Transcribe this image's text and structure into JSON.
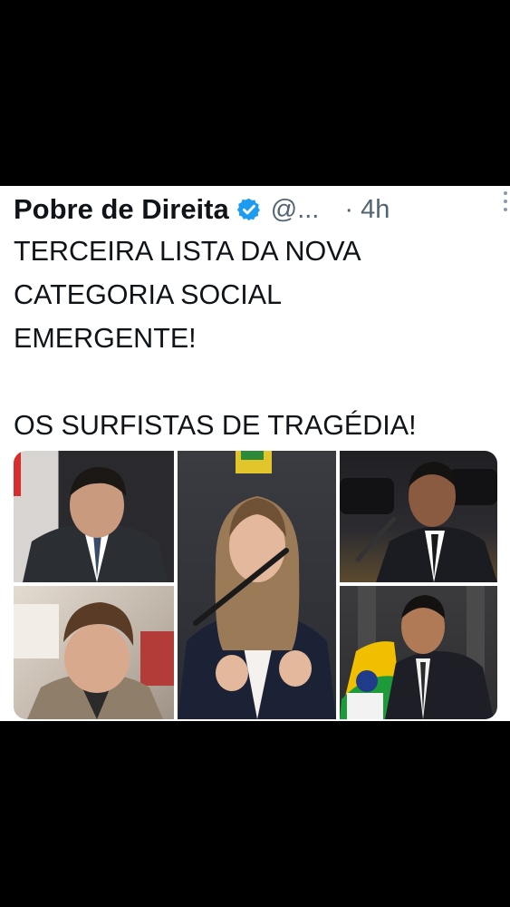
{
  "tweet": {
    "author_name": "Pobre de Direita",
    "handle": "@...",
    "time": "· 4h",
    "text_lines": [
      "TERCEIRA LISTA DA NOVA",
      "CATEGORIA SOCIAL",
      "EMERGENTE!",
      "",
      "OS SURFISTAS DE TRAGÉDIA!"
    ],
    "icons": {
      "verified": "verified-badge-icon",
      "more": "more-options-icon"
    },
    "colors": {
      "verified": "#1d9bf0",
      "text": "#0f1419",
      "muted": "#536471"
    }
  },
  "media": {
    "photos": [
      {
        "name": "photo-man-in-suit-portrait"
      },
      {
        "name": "photo-man-looking-down"
      },
      {
        "name": "photo-woman-speaking-at-microphone"
      },
      {
        "name": "photo-man-speaking-in-chamber"
      },
      {
        "name": "photo-man-with-brazil-flag"
      }
    ]
  }
}
